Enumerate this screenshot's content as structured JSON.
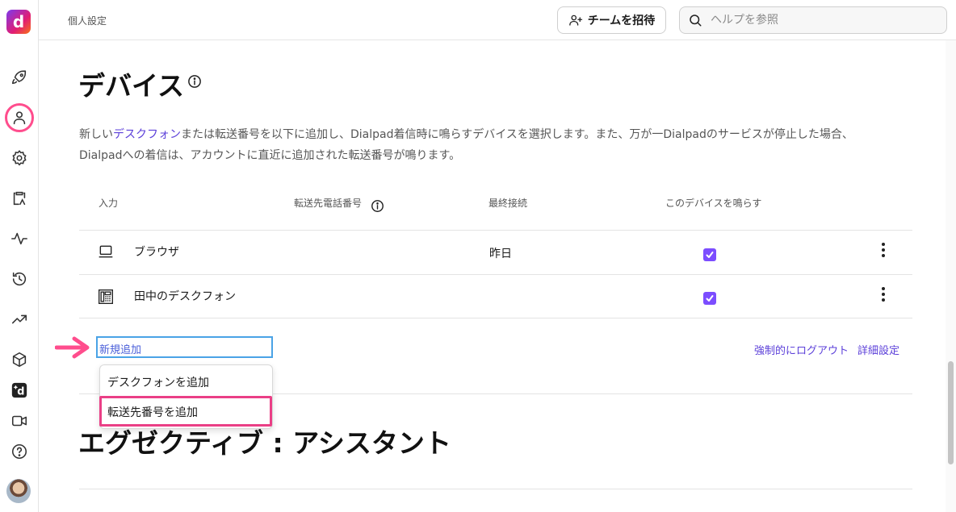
{
  "topbar": {
    "breadcrumb": "個人設定",
    "invite_label": "チームを招待",
    "search_placeholder": "ヘルプを参照"
  },
  "rail": {
    "logo_letter": "d",
    "icons": [
      "rocket-icon",
      "user-icon",
      "gear-icon",
      "clipboard-icon",
      "activity-icon",
      "history-icon",
      "trending-icon",
      "box-icon",
      "dialpad-icon",
      "video-icon",
      "help-icon"
    ],
    "active": "user-icon"
  },
  "devices": {
    "title": "デバイス",
    "desc_prefix": "新しい",
    "desc_link": "デスクフォン",
    "desc_suffix": "または転送番号を以下に追加し、Dialpad着信時に鳴らすデバイスを選択します。また、万が一Dialpadのサービスが停止した場合、Dialpadへの着信は、アカウントに直近に追加された転送番号が鳴ります。",
    "columns": [
      "入力",
      "転送先電話番号",
      "最終接続",
      "このデバイスを鳴らす"
    ],
    "rows": [
      {
        "icon": "laptop-icon",
        "label": "ブラウザ",
        "last": "昨日",
        "ring": true
      },
      {
        "icon": "deskphone-icon",
        "label": "田中のデスクフォン",
        "last": "",
        "ring": true
      }
    ],
    "add_new_label": "新規追加",
    "dropdown": [
      "デスクフォンを追加",
      "転送先番号を追加"
    ],
    "force_logout": "強制的にログアウト",
    "advanced": "詳細設定"
  },
  "exec_assistant": {
    "title": "エグゼクティブ : アシスタント"
  },
  "colors": {
    "accent": "#7c4dff",
    "link": "#5b3fd9",
    "highlight": "#ea3f86",
    "focus": "#4aa3e6"
  }
}
